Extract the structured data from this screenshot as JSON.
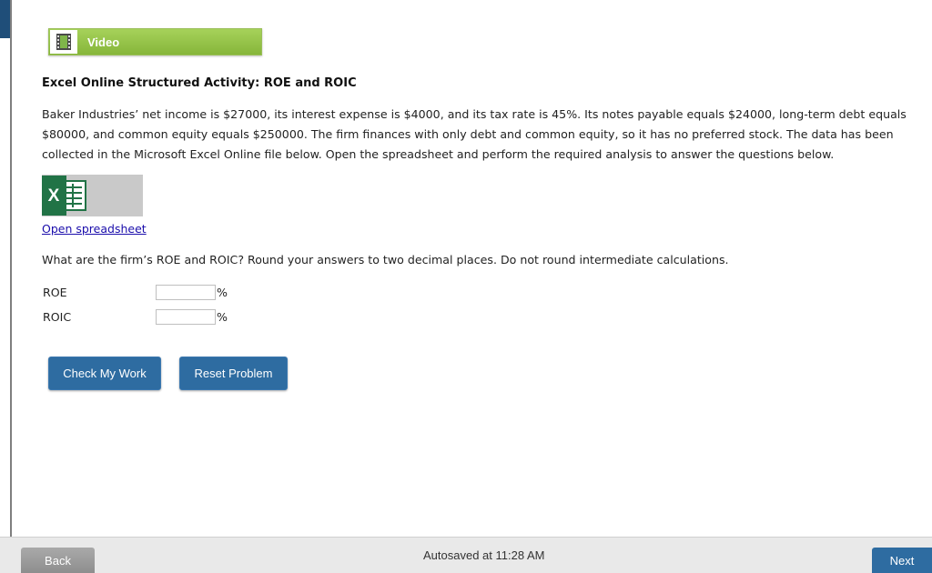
{
  "video": {
    "label": "Video",
    "icon": "film-icon"
  },
  "activity": {
    "title": "Excel Online Structured Activity: ROE and ROIC"
  },
  "problem": {
    "text": "Baker Industries’ net income is $27000, its interest expense is $4000, and its tax rate is 45%. Its notes payable equals $24000, long-term debt equals $80000, and common equity equals $250000. The firm finances with only debt and common equity, so it has no preferred stock. The data has been collected in the Microsoft Excel Online file below. Open the spreadsheet and perform the required analysis to answer the questions below."
  },
  "spreadsheet": {
    "icon": "excel-icon",
    "icon_letter": "X",
    "link_label": "Open spreadsheet"
  },
  "question": {
    "text": "What are the firm’s ROE and ROIC? Round your answers to two decimal places. Do not round intermediate calculations."
  },
  "answers": [
    {
      "label": "ROE",
      "value": "",
      "unit": "%"
    },
    {
      "label": "ROIC",
      "value": "",
      "unit": "%"
    }
  ],
  "buttons": {
    "check": "Check My Work",
    "reset": "Reset Problem"
  },
  "footer": {
    "back": "Back",
    "autosave": "Autosaved at 11:28 AM",
    "next": "Next"
  },
  "colors": {
    "accent_blue": "#2e6ca1",
    "video_green": "#96c64a",
    "excel_green": "#217346"
  }
}
